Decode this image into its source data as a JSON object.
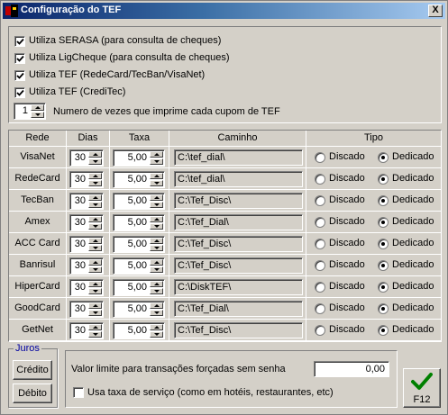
{
  "window": {
    "title": "Configuração do TEF",
    "close_label": "X"
  },
  "options": [
    {
      "label": "Utiliza SERASA (para consulta de cheques)",
      "checked": true
    },
    {
      "label": "Utiliza LigCheque (para consulta de cheques)",
      "checked": true
    },
    {
      "label": "Utiliza TEF (RedeCard/TecBan/VisaNet)",
      "checked": true
    },
    {
      "label": "Utiliza TEF (CrediTec)",
      "checked": true
    }
  ],
  "copies": {
    "value": "1",
    "label": "Numero de vezes que imprime cada cupom de TEF"
  },
  "table": {
    "headers": {
      "rede": "Rede",
      "dias": "Dias",
      "taxa": "Taxa",
      "caminho": "Caminho",
      "tipo": "Tipo"
    },
    "radio_labels": {
      "discado": "Discado",
      "dedicado": "Dedicado"
    },
    "rows": [
      {
        "rede": "VisaNet",
        "dias": "30",
        "taxa": "5,00",
        "caminho": "C:\\tef_dial\\",
        "tipo": "Dedicado"
      },
      {
        "rede": "RedeCard",
        "dias": "30",
        "taxa": "5,00",
        "caminho": "C:\\tef_dial\\",
        "tipo": "Dedicado"
      },
      {
        "rede": "TecBan",
        "dias": "30",
        "taxa": "5,00",
        "caminho": "C:\\Tef_Disc\\",
        "tipo": "Dedicado"
      },
      {
        "rede": "Amex",
        "dias": "30",
        "taxa": "5,00",
        "caminho": "C:\\Tef_Dial\\",
        "tipo": "Dedicado"
      },
      {
        "rede": "ACC Card",
        "dias": "30",
        "taxa": "5,00",
        "caminho": "C:\\Tef_Disc\\",
        "tipo": "Dedicado"
      },
      {
        "rede": "Banrisul",
        "dias": "30",
        "taxa": "5,00",
        "caminho": "C:\\Tef_Disc\\",
        "tipo": "Dedicado"
      },
      {
        "rede": "HiperCard",
        "dias": "30",
        "taxa": "5,00",
        "caminho": "C:\\DiskTEF\\",
        "tipo": "Dedicado"
      },
      {
        "rede": "GoodCard",
        "dias": "30",
        "taxa": "5,00",
        "caminho": "C:\\Tef_Dial\\",
        "tipo": "Dedicado"
      },
      {
        "rede": "GetNet",
        "dias": "30",
        "taxa": "5,00",
        "caminho": "C:\\Tef_Disc\\",
        "tipo": "Dedicado"
      }
    ]
  },
  "juros": {
    "legend": "Juros",
    "credito": "Crédito",
    "debito": "Débito"
  },
  "limite": {
    "label": "Valor limite para transações forçadas sem senha",
    "value": "0,00"
  },
  "taxa_servico": {
    "label": "Usa taxa de serviço (como em hotéis, restaurantes, etc)",
    "checked": false
  },
  "f12": {
    "label": "F12",
    "icon": "checkmark-icon",
    "icon_color": "#008000"
  }
}
